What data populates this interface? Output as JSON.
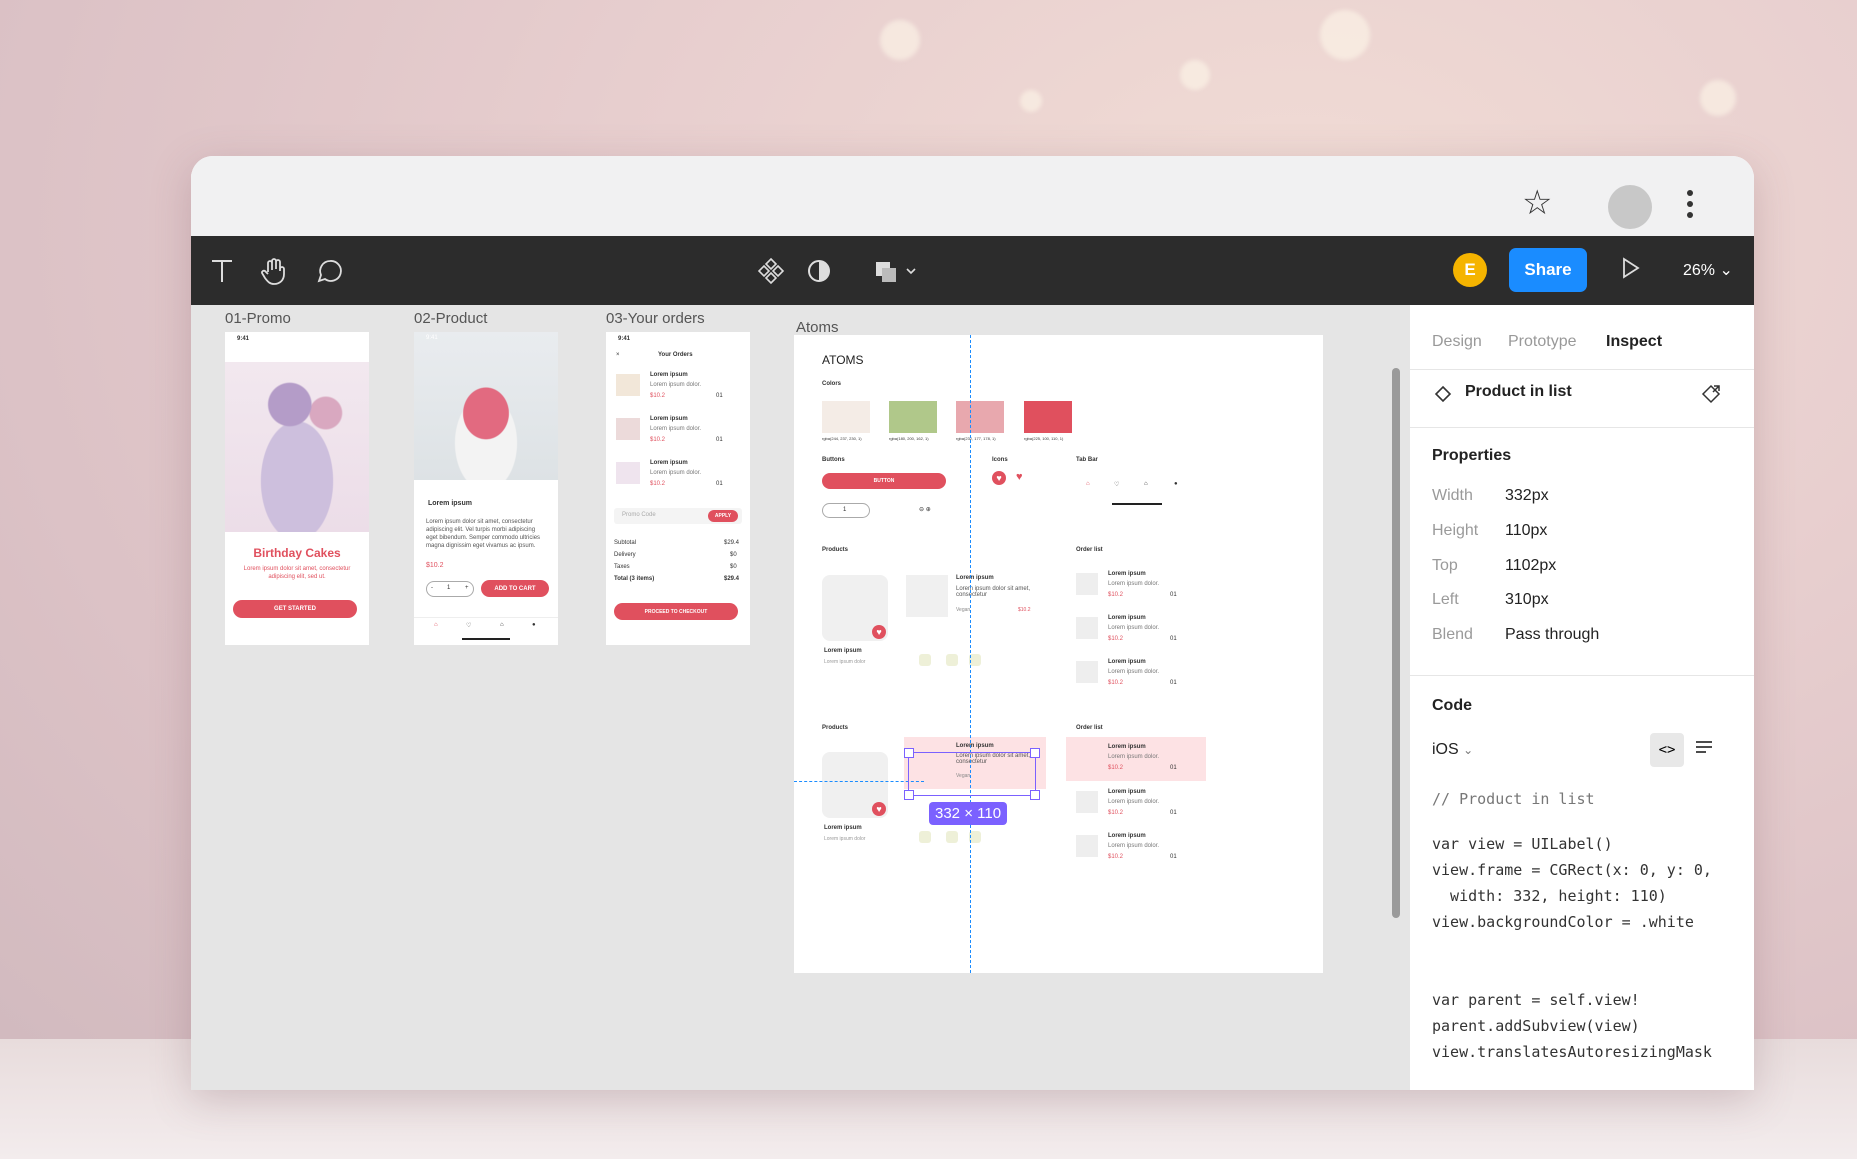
{
  "browser": {
    "bookmark_icon": "star-icon",
    "menu_icon": "kebab-icon"
  },
  "toolbar": {
    "tools": [
      "text-tool-icon",
      "hand-tool-icon",
      "comment-tool-icon"
    ],
    "center_tools": [
      "component-icon",
      "mask-icon",
      "boolean-icon"
    ],
    "user_initial": "E",
    "share_label": "Share",
    "zoom": "26%"
  },
  "canvas": {
    "frames": [
      {
        "label": "01-Promo",
        "title": "Birthday Cakes",
        "subtitle": "Lorem ipsum dolor sit amet, consectetur adipiscing elit, sed ut.",
        "button": "GET STARTED",
        "time": "9:41"
      },
      {
        "label": "02-Product",
        "product_title": "Lorem ipsum",
        "description": "Lorem ipsum dolor sit amet, consectetur adipiscing elit. Vel turpis morbi adipiscing eget bibendum. Semper commodo ultricies magna dignissim eget vivamus ac ipsum.",
        "price": "$10.2",
        "qty": "1",
        "button": "ADD TO CART",
        "time": "9:41"
      },
      {
        "label": "03-Your orders",
        "heading": "Your Orders",
        "items": [
          {
            "name": "Lorem ipsum",
            "desc": "Lorem ipsum dolor.",
            "price": "$10.2",
            "qty": "01"
          },
          {
            "name": "Lorem ipsum",
            "desc": "Lorem ipsum dolor.",
            "price": "$10.2",
            "qty": "01"
          },
          {
            "name": "Lorem ipsum",
            "desc": "Lorem ipsum dolor.",
            "price": "$10.2",
            "qty": "01"
          }
        ],
        "promo_placeholder": "Promo Code",
        "apply": "APPLY",
        "summary": [
          {
            "k": "Subtotal",
            "v": "$29.4"
          },
          {
            "k": "Delivery",
            "v": "$0"
          },
          {
            "k": "Taxes",
            "v": "$0"
          },
          {
            "k": "Total (3 items)",
            "v": "$29.4"
          }
        ],
        "checkout": "PROCEED TO CHECKOUT",
        "time": "9:41"
      }
    ],
    "atoms": {
      "label": "Atoms",
      "title": "ATOMS",
      "colors_label": "Colors",
      "swatches": [
        {
          "color": "#f4ece6",
          "caption": "rgba(244, 237, 230, 1)"
        },
        {
          "color": "#b0c88a",
          "caption": "rgba(180, 200, 162, 1)"
        },
        {
          "color": "#e8a8ae",
          "caption": "rgba(232, 177, 178, 1)"
        },
        {
          "color": "#e0505e",
          "caption": "rgba(225, 100, 110, 1)"
        }
      ],
      "buttons_label": "Buttons",
      "button_text": "BUTTON",
      "icons_label": "Icons",
      "tabbar_label": "Tab Bar",
      "products_label": "Products",
      "orderlist_label": "Order list",
      "product_name": "Lorem ipsum",
      "product_desc": "Lorem ipsum dolor",
      "list_name": "Lorem ipsum",
      "list_desc": "Lorem ipsum dolor sit amet, consectetur",
      "list_price": "$10.2",
      "list_tag": "Vegan",
      "order_name": "Lorem ipsum",
      "order_desc": "Lorem ipsum dolor.",
      "order_price": "$10.2",
      "order_qty": "01",
      "qty": "1"
    },
    "selection_size": "332 × 110"
  },
  "panel": {
    "tabs": [
      "Design",
      "Prototype",
      "Inspect"
    ],
    "active_tab": "Inspect",
    "component_name": "Product in list",
    "properties_title": "Properties",
    "properties": [
      {
        "k": "Width",
        "v": "332px"
      },
      {
        "k": "Height",
        "v": "110px"
      },
      {
        "k": "Top",
        "v": "1102px"
      },
      {
        "k": "Left",
        "v": "310px"
      },
      {
        "k": "Blend",
        "v": "Pass through"
      }
    ],
    "code_title": "Code",
    "platform": "iOS",
    "code_lines": [
      "// Product in list",
      "var view = UILabel()",
      "view.frame = CGRect(x: 0, y: 0,",
      "  width: 332, height: 110)",
      "view.backgroundColor = .white",
      "var parent = self.view!",
      "parent.addSubview(view)",
      "view.translatesAutoresizingMask"
    ]
  }
}
